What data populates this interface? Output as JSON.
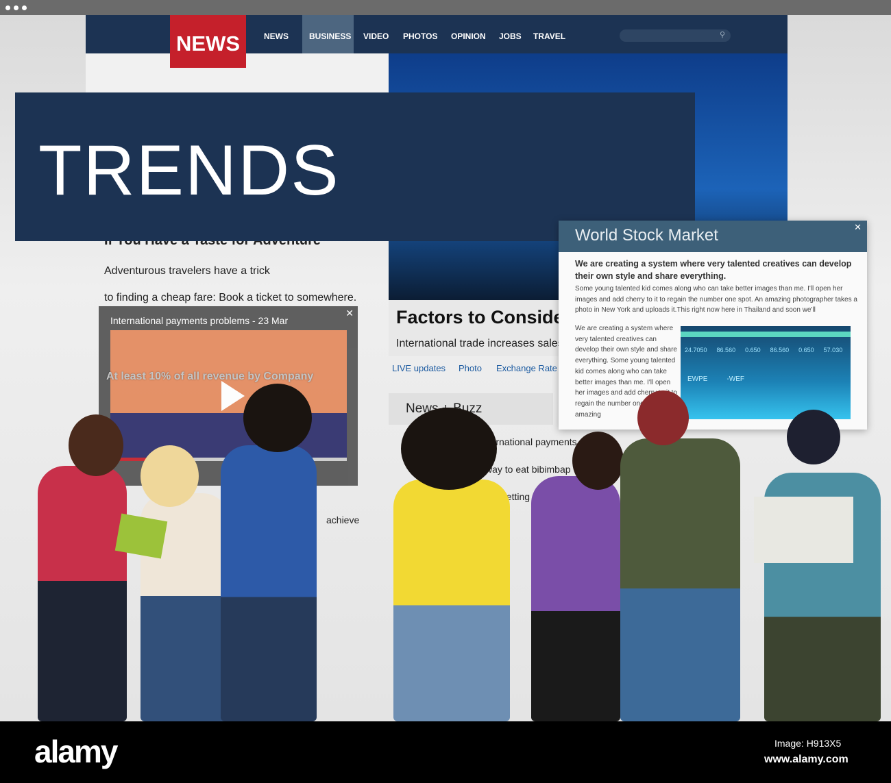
{
  "nav": {
    "logo": "NEWS",
    "items": [
      "NEWS",
      "BUSINESS",
      "VIDEO",
      "PHOTOS",
      "OPINION",
      "JOBS",
      "TRAVEL"
    ],
    "active": "BUSINESS"
  },
  "hero": {
    "title": "TRENDS"
  },
  "article": {
    "heading": "If You Have a Taste for Adventure",
    "line1": "Adventurous travelers have a trick",
    "line2": "to finding a cheap fare: Book a ticket to somewhere.",
    "faint": "At least 10% of all revenue by Company",
    "achieve": "achieve"
  },
  "video": {
    "title": "International payments problems - 23 Mar",
    "progress": 0.35
  },
  "feature": {
    "title": "Factors to Consider Before Going Global",
    "subtitle": "International trade increases sales",
    "links": [
      "LIVE updates",
      "Photo",
      "Exchange Rate"
    ]
  },
  "news": {
    "title": "News + Buzz",
    "items": [
      "International payments sa",
      "way to eat bibimbap",
      "getting rea"
    ]
  },
  "popup": {
    "title": "World Stock Market",
    "bold": "We are creating a system where very talented creatives can develop their own style and share everything.",
    "para": "Some young talented kid comes along who can take better images than me. I'll open her images and add cherry to it to regain the number one spot. An amazing photographer takes a photo in New York and uploads it.This right now here in Thailand and soon we'll",
    "side": "We are creating a system where very talented creatives can develop their own style and share everything. Some young talented kid comes along who can take better images than me. I'll open her images and add cherry to it to regain the number one spot. An amazing",
    "stock": {
      "labels": [
        "EWPE",
        "-WEF"
      ],
      "values": [
        "24.7050",
        "86.560",
        "0.650",
        "86.560",
        "0.650",
        "57.030"
      ]
    }
  },
  "footer": {
    "brand": "alamy",
    "image_id": "Image: H913X5",
    "site": "www.alamy.com"
  },
  "colors": {
    "navy": "#1c3353",
    "red": "#c5202b"
  }
}
